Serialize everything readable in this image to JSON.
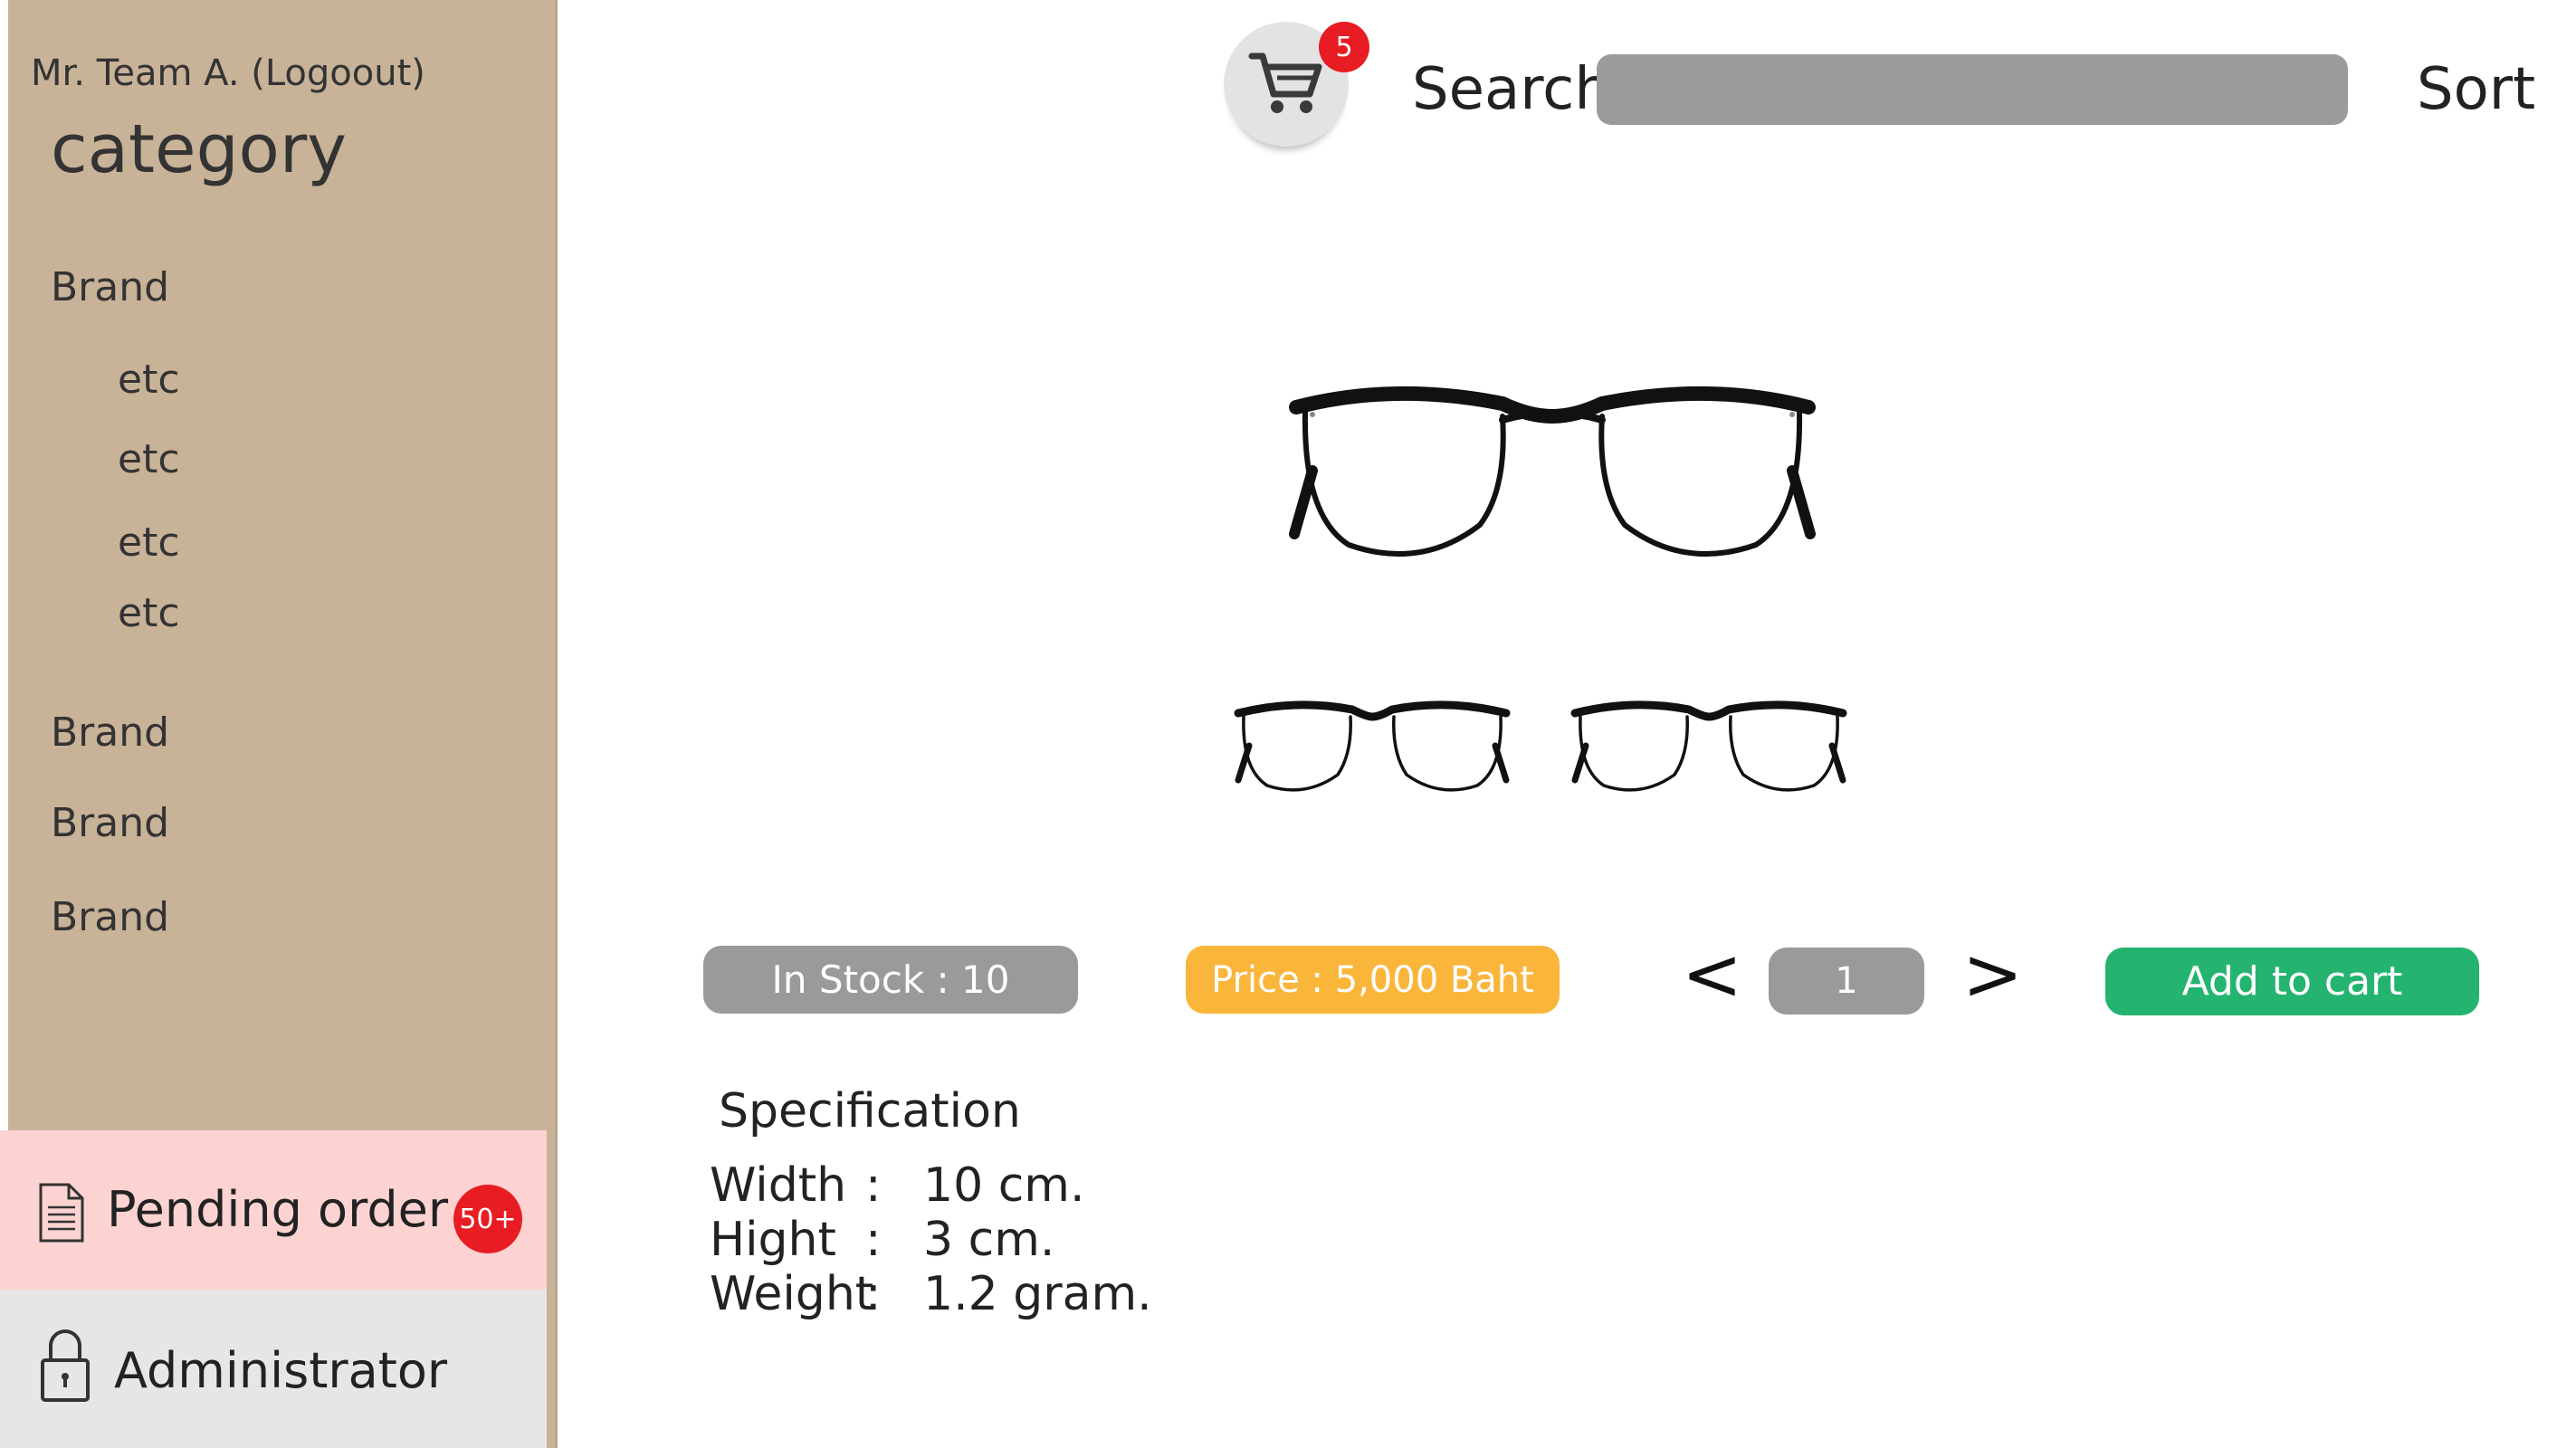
{
  "sidebar": {
    "user_line": "Mr. Team A. (Logoout)",
    "category_title": "category",
    "items": [
      {
        "label": "Brand"
      },
      {
        "label": "etc"
      },
      {
        "label": "etc"
      },
      {
        "label": "etc"
      },
      {
        "label": "etc"
      },
      {
        "label": "Brand"
      },
      {
        "label": "Brand"
      },
      {
        "label": "Brand"
      }
    ],
    "pending": {
      "label": "Pending order",
      "badge": "50+",
      "icon": "document-icon"
    },
    "admin": {
      "label": "Administrator",
      "icon": "lock-icon"
    }
  },
  "header": {
    "cart_icon": "cart-icon",
    "cart_count": "5",
    "search_label": "Search",
    "search_placeholder": "",
    "sort_label": "Sort"
  },
  "product": {
    "stock": "In Stock : 10",
    "price": "Price : 5,000 Baht",
    "qty_prev": "<",
    "quantity": "1",
    "qty_next": ">",
    "add_to_cart": "Add to cart"
  },
  "spec": {
    "title": "Specification",
    "rows": [
      {
        "key": "Width",
        "sep": ":",
        "value": "10 cm."
      },
      {
        "key": "Hight",
        "sep": ":",
        "value": "3 cm."
      },
      {
        "key": "Weight",
        "sep": ":",
        "value": "1.2 gram."
      }
    ]
  },
  "colors": {
    "sidebar": "#c8b298",
    "pending_bg": "#fdd3d2",
    "admin_bg": "#e6e6e6",
    "badge_red": "#e71d23",
    "stock_gray": "#9a9a9a",
    "price_orange": "#fab53b",
    "cart_green": "#24b46f"
  }
}
